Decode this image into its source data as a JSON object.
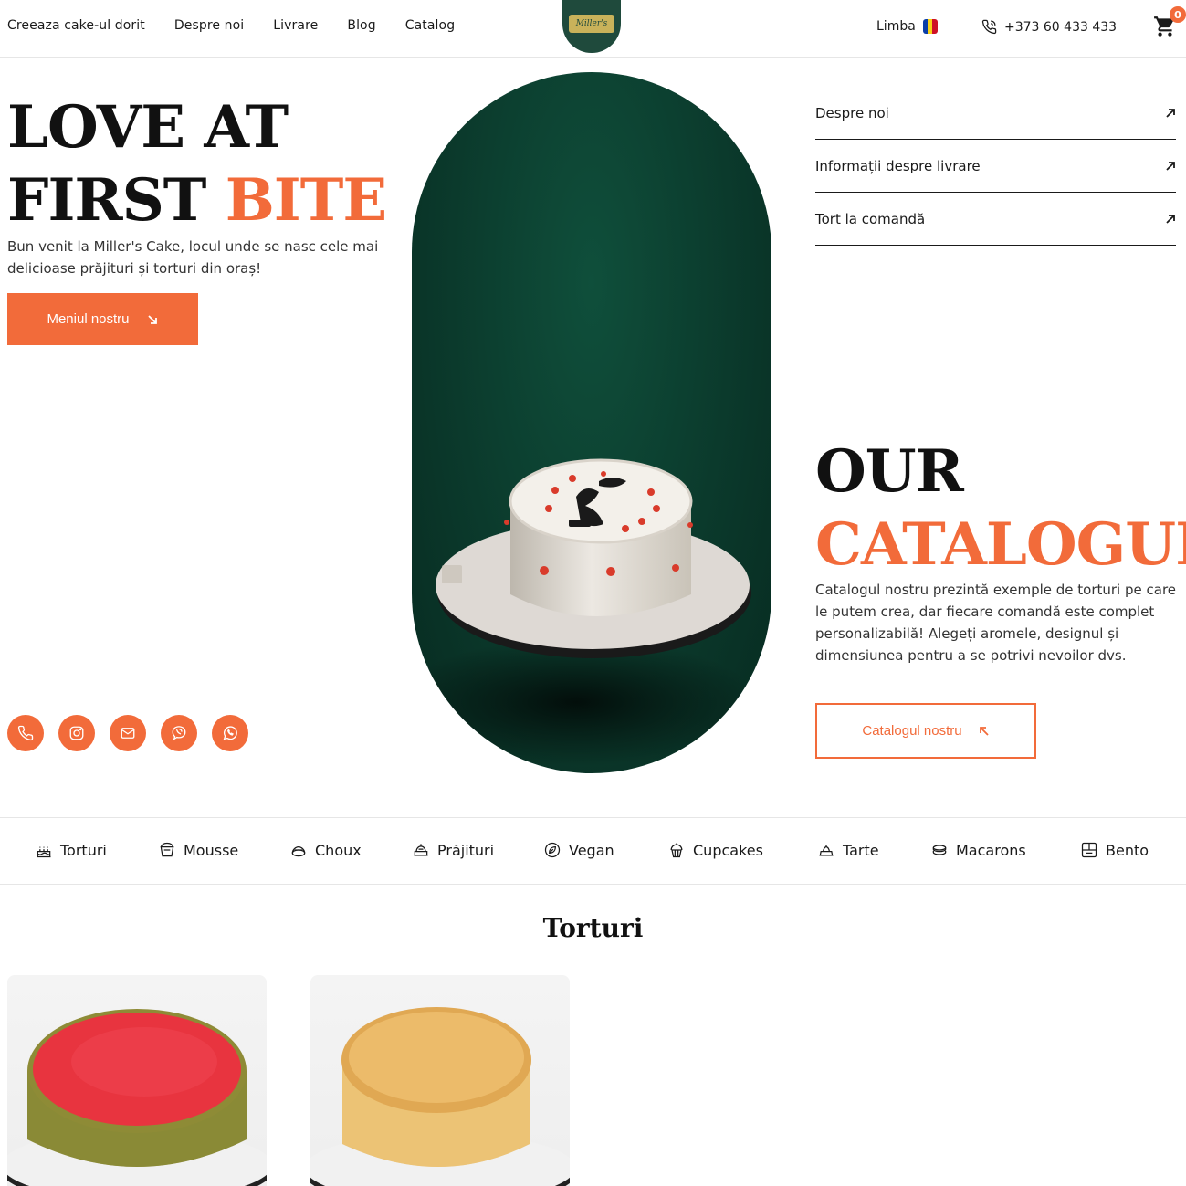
{
  "header": {
    "nav": [
      "Creeaza cake-ul dorit",
      "Despre noi",
      "Livrare",
      "Blog",
      "Catalog"
    ],
    "logo_text": "Miller's",
    "language_label": "Limba",
    "phone": "+373 60 433 433",
    "cart_count": "0"
  },
  "hero": {
    "title_line1": "LOVE AT",
    "title_line2_plain": "FIRST ",
    "title_line2_accent": "BITE",
    "subtitle": "Bun venit la Miller's Cake, locul unde se nasc cele mai delicioase prăjituri și torturi din oraș!",
    "menu_button": "Meniul nostru"
  },
  "socials": [
    "phone-icon",
    "instagram-icon",
    "mail-icon",
    "viber-icon",
    "whatsapp-icon"
  ],
  "right_links": [
    "Despre noi",
    "Informații despre livrare",
    "Tort la comandă"
  ],
  "catalogue": {
    "title_line1": "OUR",
    "title_line2": "CATALOGUE",
    "text": "Catalogul nostru prezintă exemple de torturi pe care le putem crea, dar fiecare comandă este complet personalizabilă! Alegeți aromele, designul și dimensiunea pentru a se potrivi nevoilor dvs.",
    "button": "Catalogul nostru"
  },
  "categories": [
    "Torturi",
    "Mousse",
    "Choux",
    "Prăjituri",
    "Vegan",
    "Cupcakes",
    "Tarte",
    "Macarons",
    "Bento"
  ],
  "section_title": "Torturi",
  "colors": {
    "accent": "#f26b3a",
    "brand_green": "#1f4a3c"
  }
}
